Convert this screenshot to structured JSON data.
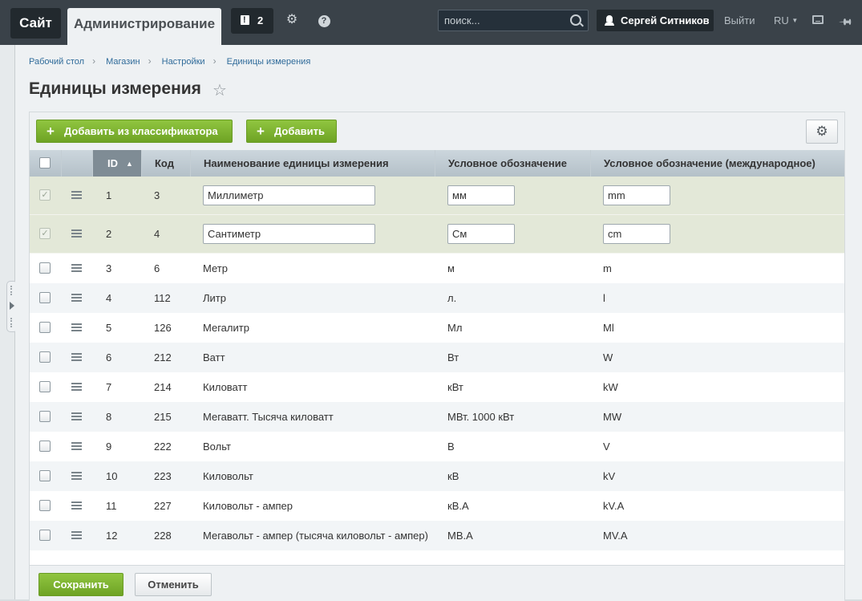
{
  "topbar": {
    "site_tab": "Сайт",
    "admin_tab": "Администрирование",
    "notifications_count": "2",
    "search_placeholder": "поиск...",
    "user_name": "Сергей Ситников",
    "logout": "Выйти",
    "language": "RU",
    "icons": [
      "notification-icon",
      "gear-icon",
      "help-icon",
      "search-icon",
      "user-icon",
      "keyboard-icon",
      "pin-icon"
    ]
  },
  "breadcrumbs": [
    "Рабочий стол",
    "Магазин",
    "Настройки",
    "Единицы измерения"
  ],
  "page_title": "Единицы измерения",
  "toolbar": {
    "add_from_classifier": "Добавить из классификатора",
    "add": "Добавить"
  },
  "table": {
    "columns": [
      "ID",
      "Код",
      "Наименование единицы измерения",
      "Условное обозначение",
      "Условное обозначение (международное)"
    ],
    "rows": [
      {
        "id": "1",
        "code": "3",
        "name": "Миллиметр",
        "symbol": "мм",
        "intl": "mm",
        "editing": true,
        "checked": true
      },
      {
        "id": "2",
        "code": "4",
        "name": "Сантиметр",
        "symbol": "См",
        "intl": "cm",
        "editing": true,
        "checked": true
      },
      {
        "id": "3",
        "code": "6",
        "name": "Метр",
        "symbol": "м",
        "intl": "m"
      },
      {
        "id": "4",
        "code": "112",
        "name": "Литр",
        "symbol": "л.",
        "intl": "l"
      },
      {
        "id": "5",
        "code": "126",
        "name": "Мегалитр",
        "symbol": "Мл",
        "intl": "Ml"
      },
      {
        "id": "6",
        "code": "212",
        "name": "Ватт",
        "symbol": "Вт",
        "intl": "W"
      },
      {
        "id": "7",
        "code": "214",
        "name": "Киловатт",
        "symbol": "кВт",
        "intl": "kW"
      },
      {
        "id": "8",
        "code": "215",
        "name": "Мегаватт. Тысяча киловатт",
        "symbol": "МВт. 1000 кВт",
        "intl": "MW"
      },
      {
        "id": "9",
        "code": "222",
        "name": "Вольт",
        "symbol": "В",
        "intl": "V"
      },
      {
        "id": "10",
        "code": "223",
        "name": "Киловольт",
        "symbol": "кВ",
        "intl": "kV"
      },
      {
        "id": "11",
        "code": "227",
        "name": "Киловольт - ампер",
        "symbol": "кВ.А",
        "intl": "kV.A"
      },
      {
        "id": "12",
        "code": "228",
        "name": "Мегавольт - ампер (тысяча киловольт - ампер)",
        "symbol": "МВ.А",
        "intl": "MV.A"
      }
    ]
  },
  "footer": {
    "save": "Сохранить",
    "cancel": "Отменить"
  },
  "colors": {
    "topbar": "#3a4249",
    "accent_green": "#7bb12e",
    "editing_row": "#e3e8d8",
    "sorted_header": "#7f8c95"
  }
}
